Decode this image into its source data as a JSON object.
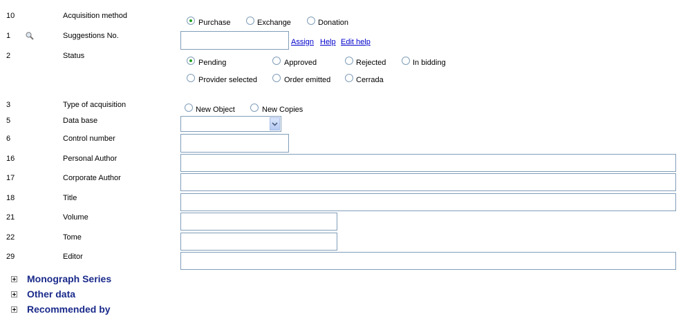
{
  "rows": [
    {
      "num": "10",
      "label": "Acquisition method"
    },
    {
      "num": "1",
      "label": "Suggestions No."
    },
    {
      "num": "2",
      "label": "Status"
    },
    {
      "num": "3",
      "label": "Type of acquisition"
    },
    {
      "num": "5",
      "label": "Data base"
    },
    {
      "num": "6",
      "label": "Control number"
    },
    {
      "num": "16",
      "label": "Personal Author"
    },
    {
      "num": "17",
      "label": "Corporate Author"
    },
    {
      "num": "18",
      "label": "Title"
    },
    {
      "num": "21",
      "label": "Volume"
    },
    {
      "num": "22",
      "label": "Tome"
    },
    {
      "num": "29",
      "label": "Editor"
    }
  ],
  "acquisition_method": {
    "options": [
      "Purchase",
      "Exchange",
      "Donation"
    ],
    "selected": "Purchase"
  },
  "suggestions": {
    "value": "",
    "links": [
      "Assign",
      "Help",
      "Edit help"
    ]
  },
  "status": {
    "options": [
      "Pending",
      "Approved",
      "Rejected",
      "In bidding",
      "Provider selected",
      "Order emitted",
      "Cerrada"
    ],
    "selected": "Pending"
  },
  "type_of_acquisition": {
    "options": [
      "New Object",
      "New Copies"
    ],
    "selected": ""
  },
  "database": {
    "selected": ""
  },
  "fields": {
    "control_number": "",
    "personal_author": "",
    "corporate_author": "",
    "title": "",
    "volume": "",
    "tome": "",
    "editor": ""
  },
  "sections": [
    "Monograph Series",
    "Other data",
    "Recommended by"
  ],
  "icons": {
    "suggestion_lookup": "magnifier-icon",
    "expand": "plus-box-icon"
  }
}
